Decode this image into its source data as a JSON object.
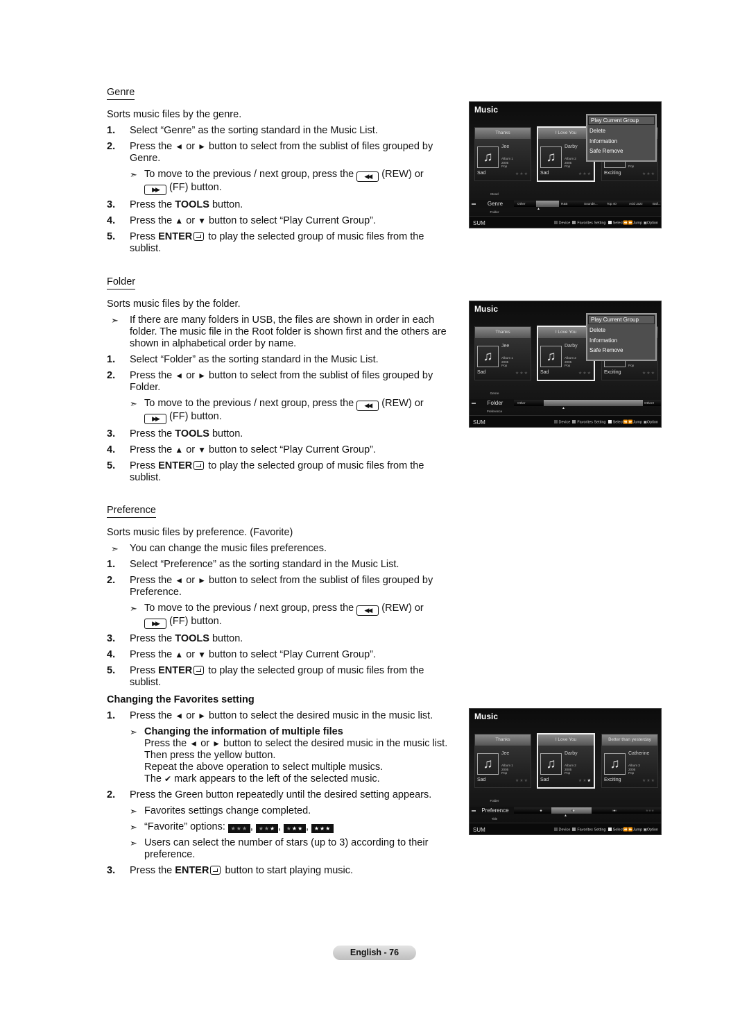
{
  "sections": [
    {
      "id": "genre",
      "heading": "Genre",
      "underline": true,
      "lines": [
        {
          "kind": "text",
          "segs": [
            {
              "t": "Sorts music files by the genre."
            }
          ]
        },
        {
          "kind": "num",
          "n": "1.",
          "segs": [
            {
              "t": "Select “Genre” as the sorting standard in the Music List."
            }
          ]
        },
        {
          "kind": "num",
          "n": "2.",
          "segs": [
            {
              "t": "Press the "
            },
            {
              "icon": "left-arrow-icon"
            },
            {
              "t": " or "
            },
            {
              "icon": "right-arrow-icon"
            },
            {
              "t": " button to select from the sublist of files grouped by"
            },
            {
              "br": true
            },
            {
              "t": "Genre."
            }
          ]
        },
        {
          "kind": "sub",
          "segs": [
            {
              "t": "To move to the previous / next group, press the "
            },
            {
              "icon": "rew-button-icon"
            },
            {
              "t": " (REW) or"
            },
            {
              "br": true
            },
            {
              "icon": "ff-button-icon"
            },
            {
              "t": " (FF) button."
            }
          ]
        },
        {
          "kind": "num",
          "n": "3.",
          "segs": [
            {
              "t": "Press the "
            },
            {
              "b": "TOOLS"
            },
            {
              "t": " button."
            }
          ]
        },
        {
          "kind": "num",
          "n": "4.",
          "segs": [
            {
              "t": "Press the "
            },
            {
              "icon": "up-arrow-icon"
            },
            {
              "t": " or "
            },
            {
              "icon": "down-arrow-icon"
            },
            {
              "t": " button to select “Play Current Group”."
            }
          ]
        },
        {
          "kind": "num",
          "n": "5.",
          "segs": [
            {
              "t": "Press "
            },
            {
              "b": "ENTER"
            },
            {
              "icon": "enter-icon"
            },
            {
              "t": " to play the selected group of music files from the"
            },
            {
              "br": true
            },
            {
              "t": "sublist."
            }
          ]
        }
      ]
    },
    {
      "id": "folder",
      "heading": "Folder",
      "underline": true,
      "lines": [
        {
          "kind": "text",
          "segs": [
            {
              "t": "Sorts music files by the folder."
            }
          ]
        },
        {
          "kind": "note",
          "segs": [
            {
              "t": "If there are many folders in USB, the files are shown in order in each"
            },
            {
              "br": true
            },
            {
              "t": "folder. The music file in the Root folder is shown first and the others are"
            },
            {
              "br": true
            },
            {
              "t": "shown in alphabetical order by name."
            }
          ]
        },
        {
          "kind": "num",
          "n": "1.",
          "segs": [
            {
              "t": "Select “Folder” as the sorting standard in the Music List."
            }
          ]
        },
        {
          "kind": "num",
          "n": "2.",
          "segs": [
            {
              "t": "Press the "
            },
            {
              "icon": "left-arrow-icon"
            },
            {
              "t": " or "
            },
            {
              "icon": "right-arrow-icon"
            },
            {
              "t": " button to select from the sublist of files grouped by"
            },
            {
              "br": true
            },
            {
              "t": "Folder."
            }
          ]
        },
        {
          "kind": "sub",
          "segs": [
            {
              "t": "To move to the previous / next group, press the "
            },
            {
              "icon": "rew-button-icon"
            },
            {
              "t": " (REW) or"
            },
            {
              "br": true
            },
            {
              "icon": "ff-button-icon"
            },
            {
              "t": " (FF) button."
            }
          ]
        },
        {
          "kind": "num",
          "n": "3.",
          "segs": [
            {
              "t": "Press the "
            },
            {
              "b": "TOOLS"
            },
            {
              "t": " button."
            }
          ]
        },
        {
          "kind": "num",
          "n": "4.",
          "segs": [
            {
              "t": "Press the "
            },
            {
              "icon": "up-arrow-icon"
            },
            {
              "t": " or "
            },
            {
              "icon": "down-arrow-icon"
            },
            {
              "t": " button to select “Play Current Group”."
            }
          ]
        },
        {
          "kind": "num",
          "n": "5.",
          "segs": [
            {
              "t": "Press "
            },
            {
              "b": "ENTER"
            },
            {
              "icon": "enter-icon"
            },
            {
              "t": " to play the selected group of music files from the"
            },
            {
              "br": true
            },
            {
              "t": "sublist."
            }
          ]
        }
      ]
    },
    {
      "id": "preference",
      "heading": "Preference",
      "underline": true,
      "lines": [
        {
          "kind": "text",
          "segs": [
            {
              "t": "Sorts music files by preference. (Favorite)"
            }
          ]
        },
        {
          "kind": "note",
          "segs": [
            {
              "t": "You can change the music files preferences."
            }
          ]
        },
        {
          "kind": "num",
          "n": "1.",
          "segs": [
            {
              "t": "Select “Preference” as the sorting standard in the Music List."
            }
          ]
        },
        {
          "kind": "num",
          "n": "2.",
          "segs": [
            {
              "t": "Press the "
            },
            {
              "icon": "left-arrow-icon"
            },
            {
              "t": " or "
            },
            {
              "icon": "right-arrow-icon"
            },
            {
              "t": " button to select from the sublist of files grouped by"
            },
            {
              "br": true
            },
            {
              "t": "Preference."
            }
          ]
        },
        {
          "kind": "sub",
          "segs": [
            {
              "t": "To move to the previous / next group, press the "
            },
            {
              "icon": "rew-button-icon"
            },
            {
              "t": " (REW) or"
            },
            {
              "br": true
            },
            {
              "icon": "ff-button-icon"
            },
            {
              "t": " (FF) button."
            }
          ]
        },
        {
          "kind": "num",
          "n": "3.",
          "segs": [
            {
              "t": "Press the "
            },
            {
              "b": "TOOLS"
            },
            {
              "t": " button."
            }
          ]
        },
        {
          "kind": "num",
          "n": "4.",
          "segs": [
            {
              "t": "Press the "
            },
            {
              "icon": "up-arrow-icon"
            },
            {
              "t": " or "
            },
            {
              "icon": "down-arrow-icon"
            },
            {
              "t": " button to select “Play Current Group”."
            }
          ]
        },
        {
          "kind": "num",
          "n": "5.",
          "segs": [
            {
              "t": "Press "
            },
            {
              "b": "ENTER"
            },
            {
              "icon": "enter-icon"
            },
            {
              "t": " to play the selected group of music files from the"
            },
            {
              "br": true
            },
            {
              "t": "sublist."
            }
          ]
        }
      ]
    },
    {
      "id": "favorites",
      "heading": "Changing the Favorites setting",
      "underline": false,
      "lines": [
        {
          "kind": "num",
          "n": "1.",
          "segs": [
            {
              "t": "Press the "
            },
            {
              "icon": "left-arrow-icon"
            },
            {
              "t": " or "
            },
            {
              "icon": "right-arrow-icon"
            },
            {
              "t": " button to select the desired music in the music list."
            }
          ]
        },
        {
          "kind": "sub",
          "bold": true,
          "segs": [
            {
              "t": "Changing the information of multiple files"
            }
          ]
        },
        {
          "kind": "cont",
          "segs": [
            {
              "t": "Press the "
            },
            {
              "icon": "left-arrow-icon"
            },
            {
              "t": " or "
            },
            {
              "icon": "right-arrow-icon"
            },
            {
              "t": " button to select the desired music in the music list."
            },
            {
              "br": true
            },
            {
              "t": "Then press the yellow button."
            },
            {
              "br": true
            },
            {
              "t": "Repeat the above operation to select multiple musics."
            },
            {
              "br": true
            },
            {
              "t": "The "
            },
            {
              "icon": "check-mark-icon"
            },
            {
              "t": " mark appears to the left of the selected music."
            }
          ]
        },
        {
          "kind": "num",
          "n": "2.",
          "segs": [
            {
              "t": "Press the Green button repeatedly until the desired setting appears."
            }
          ]
        },
        {
          "kind": "sub",
          "segs": [
            {
              "t": "Favorites settings change completed."
            }
          ]
        },
        {
          "kind": "sub",
          "segs": [
            {
              "t": "“Favorite” options: "
            },
            {
              "fav": 0
            },
            {
              "t": ", "
            },
            {
              "fav": 1
            },
            {
              "t": ", "
            },
            {
              "fav": 2
            },
            {
              "t": ", "
            },
            {
              "fav": 3
            }
          ]
        },
        {
          "kind": "sub",
          "segs": [
            {
              "t": "Users can select the number of stars (up to 3) according to their"
            },
            {
              "br": true
            },
            {
              "t": "preference."
            }
          ]
        },
        {
          "kind": "num",
          "n": "3.",
          "segs": [
            {
              "t": "Press the "
            },
            {
              "b": "ENTER"
            },
            {
              "icon": "enter-icon"
            },
            {
              "t": " button to start playing music."
            }
          ]
        }
      ]
    }
  ],
  "screens": [
    {
      "id": "genre-screen",
      "title": "Music",
      "cards": [
        {
          "title": "Thanks",
          "artist": "Jee",
          "album": "Album 1",
          "year": "2005",
          "genre": "Pop",
          "mood": "Sad",
          "stars_lit": 0
        },
        {
          "title": "I Love You",
          "artist": "Darby",
          "album": "Album 2",
          "year": "2005",
          "genre": "Pop",
          "mood": "Sad",
          "stars_lit": 0
        },
        {
          "title": "",
          "artist": "",
          "album": "",
          "year": "",
          "genre": "Pop",
          "mood": "Exciting",
          "stars_lit": 0
        }
      ],
      "menu": [
        "Play Current Group",
        "Delete",
        "Information",
        "Safe Remove"
      ],
      "category": {
        "up": "Mood",
        "current": "Genre",
        "down": "Folder"
      },
      "groups": [
        "Other",
        "Pop",
        "R&B",
        "Soundtr...",
        "Top 40",
        "Acid Jazz",
        "Ball..."
      ],
      "selected_group": 1,
      "footer": {
        "left": "SUM",
        "legend": [
          "Device",
          "Favorites Setting",
          "Select",
          "Jump",
          "Option"
        ]
      }
    },
    {
      "id": "folder-screen",
      "title": "Music",
      "cards": [
        {
          "title": "Thanks",
          "artist": "Jee",
          "album": "Album 1",
          "year": "2005",
          "genre": "Pop",
          "mood": "Sad",
          "stars_lit": 0
        },
        {
          "title": "I Love You",
          "artist": "Darby",
          "album": "Album 2",
          "year": "2005",
          "genre": "Pop",
          "mood": "Sad",
          "stars_lit": 0
        },
        {
          "title": "",
          "artist": "",
          "album": "",
          "year": "",
          "genre": "Pop",
          "mood": "Exciting",
          "stars_lit": 0
        }
      ],
      "menu": [
        "Play Current Group",
        "Delete",
        "Information",
        "Safe Remove"
      ],
      "category": {
        "up": "Genre",
        "current": "Folder",
        "down": "Preference"
      },
      "groups": [
        "Other",
        "Music",
        "Other2"
      ],
      "selected_group": 1,
      "footer": {
        "left": "SUM",
        "legend": [
          "Device",
          "Favorites Setting",
          "Select",
          "Jump",
          "Option"
        ]
      }
    },
    {
      "id": "preference-screen",
      "title": "Music",
      "cards": [
        {
          "title": "Thanks",
          "artist": "Jee",
          "album": "Album 1",
          "year": "2005",
          "genre": "Pop",
          "mood": "Sad",
          "stars_lit": 0
        },
        {
          "title": "I Love You",
          "artist": "Darby",
          "album": "Album 2",
          "year": "2005",
          "genre": "Pop",
          "mood": "Sad",
          "stars_lit": 1
        },
        {
          "title": "Better than yesterday",
          "artist": "Catherine",
          "album": "Album 3",
          "year": "2005",
          "genre": "Pop",
          "mood": "Exciting",
          "stars_lit": 0
        }
      ],
      "menu": [],
      "category": {
        "up": "Folder",
        "current": "Preference",
        "down": "Title"
      },
      "groups": [
        {
          "stars_lit": 0
        },
        {
          "stars_lit": 1
        },
        {
          "stars_lit": 2
        },
        {
          "stars_lit": 3
        }
      ],
      "selected_group": 1,
      "footer": {
        "left": "SUM",
        "legend": [
          "Device",
          "Favorites Setting",
          "Select",
          "Jump",
          "Option"
        ]
      }
    }
  ],
  "favorite_options": [
    0,
    1,
    2,
    3
  ],
  "footer_legend_colors": [
    "#555555",
    "#999999",
    "#eeeeee"
  ],
  "page_label": "English - 76"
}
